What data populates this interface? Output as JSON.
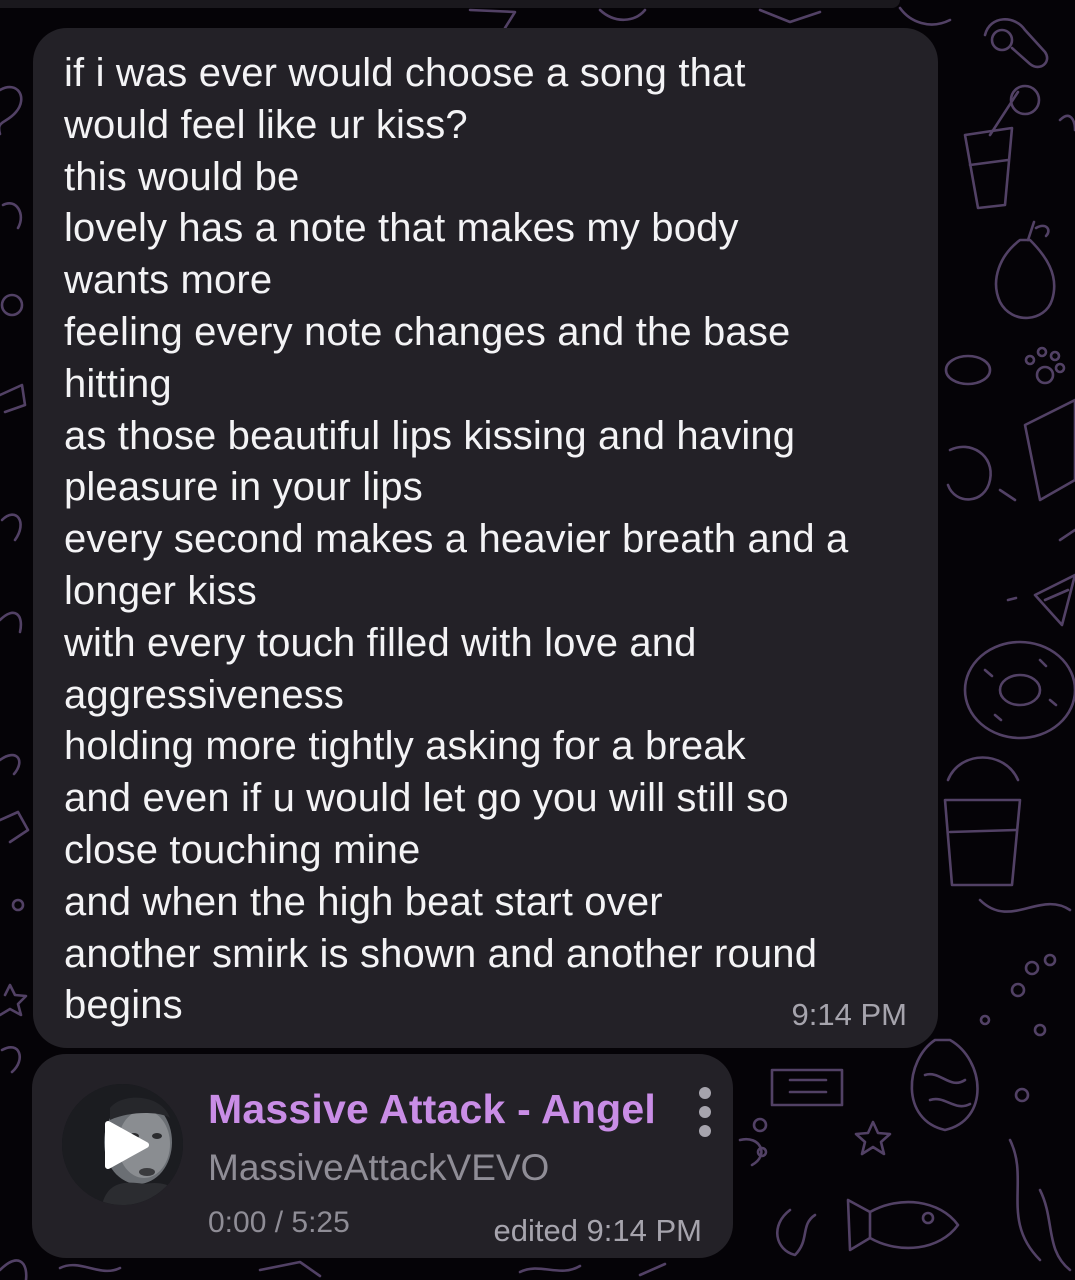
{
  "theme": {
    "background": "#050307",
    "bubble": "#232127",
    "doodle": "#5b4870",
    "message_text": "#f3f3f5",
    "meta_text": "#a6a4ad",
    "accent": "#c98de6"
  },
  "message": {
    "text": "if i was ever would choose a song that\nwould feel like ur kiss?\nthis would be\nlovely has a note that makes my body\nwants more\nfeeling every note changes and the base\nhitting\nas those beautiful lips kissing and having\npleasure in your lips\nevery second makes a heavier breath and a\nlonger kiss\nwith every touch filled with love and\naggressiveness\nholding more tightly asking for a break\nand even if u would let go you will still so\nclose touching mine\nand when the high beat start over\nanother smirk is shown and another round\nbegins",
    "time": "9:14 PM"
  },
  "media": {
    "title": "Massive Attack - Angel",
    "channel": "MassiveAttackVEVO",
    "progress": "0:00 / 5:25",
    "edited": "edited 9:14 PM",
    "play_icon": "play-icon",
    "menu_icon": "more-vertical-icon"
  }
}
